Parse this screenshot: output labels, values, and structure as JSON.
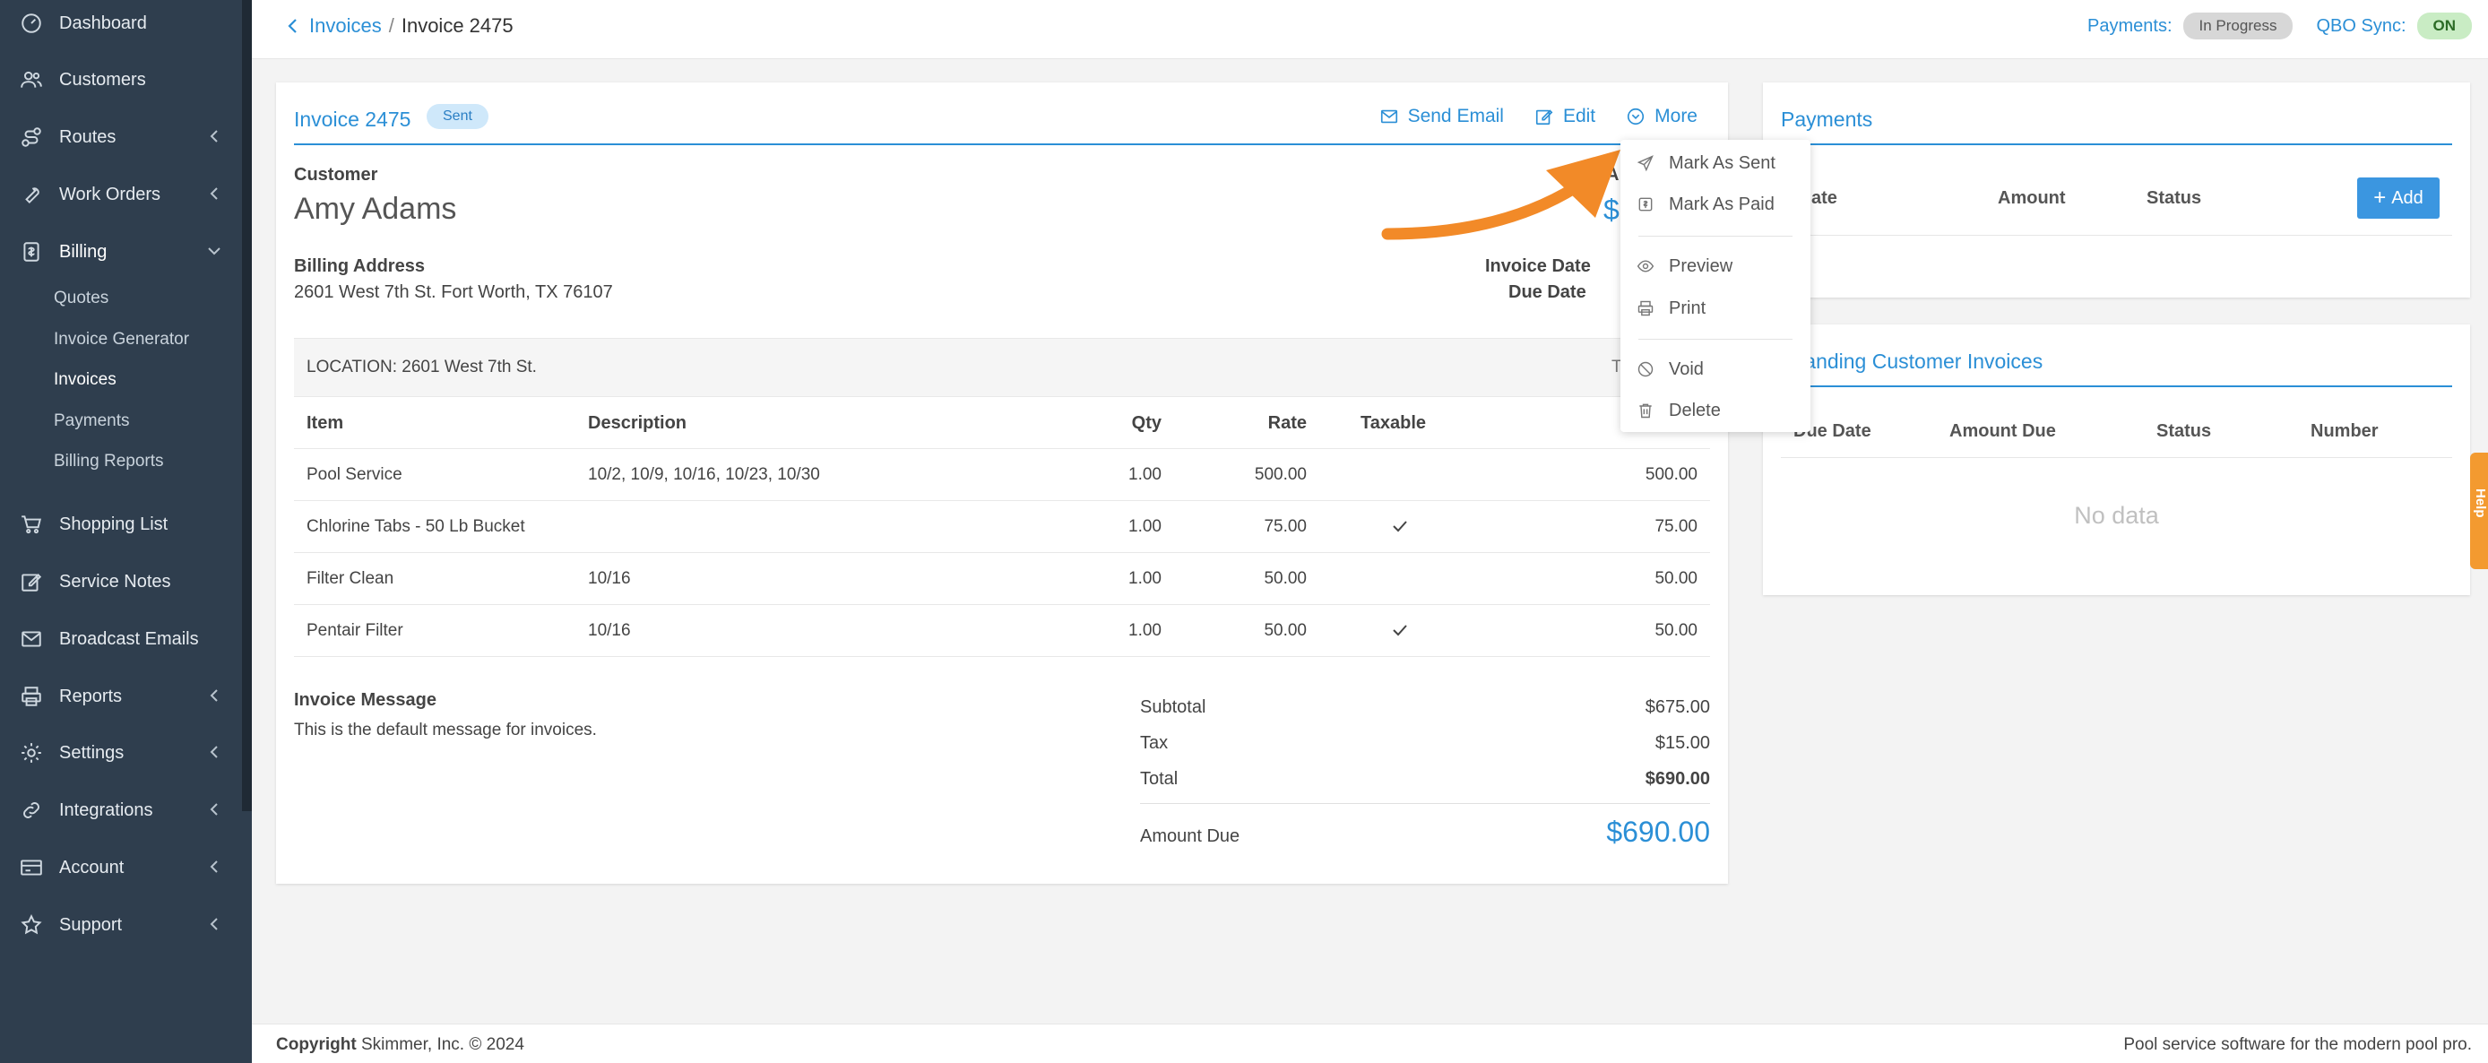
{
  "sidebar": {
    "items": [
      {
        "label": "Dashboard",
        "icon": "dashboard-icon"
      },
      {
        "label": "Customers",
        "icon": "users-icon"
      },
      {
        "label": "Routes",
        "icon": "route-icon"
      },
      {
        "label": "Work Orders",
        "icon": "wrench-icon"
      },
      {
        "label": "Billing",
        "icon": "billing-icon"
      },
      {
        "label": "Shopping List",
        "icon": "cart-icon"
      },
      {
        "label": "Service Notes",
        "icon": "edit-icon"
      },
      {
        "label": "Broadcast Emails",
        "icon": "mail-icon"
      },
      {
        "label": "Reports",
        "icon": "printer-icon"
      },
      {
        "label": "Settings",
        "icon": "gear-icon"
      },
      {
        "label": "Integrations",
        "icon": "link-icon"
      },
      {
        "label": "Account",
        "icon": "card-icon"
      },
      {
        "label": "Support",
        "icon": "star-icon"
      }
    ],
    "billing_sub": [
      "Quotes",
      "Invoice Generator",
      "Invoices",
      "Payments",
      "Billing Reports"
    ]
  },
  "topbar": {
    "crumb_parent": "Invoices",
    "crumb_sep": "/",
    "crumb_current": "Invoice 2475",
    "payments_label": "Payments:",
    "payments_status": "In Progress",
    "qbo_label": "QBO Sync:",
    "qbo_status": "ON"
  },
  "invoice": {
    "title": "Invoice 2475",
    "status_badge": "Sent",
    "actions": {
      "send_email": "Send Email",
      "edit": "Edit",
      "more": "More"
    },
    "customer_label": "Customer",
    "customer_name": "Amy Adams",
    "billing_address_label": "Billing Address",
    "billing_address": "2601 West 7th St. Fort Worth, TX 76107",
    "invoice_date_label": "Invoice Date",
    "due_date_label": "Due Date",
    "partial_a": "A",
    "partial_dollar": "$",
    "location": "LOCATION: 2601 West 7th St.",
    "location_tax": "Tax",
    "columns": {
      "item": "Item",
      "description": "Description",
      "qty": "Qty",
      "rate": "Rate",
      "taxable": "Taxable"
    },
    "rows": [
      {
        "item": "Pool Service",
        "description": "10/2, 10/9, 10/16, 10/23, 10/30",
        "qty": "1.00",
        "rate": "500.00",
        "taxable": false,
        "amount": "500.00"
      },
      {
        "item": "Chlorine Tabs - 50 Lb Bucket",
        "description": "",
        "qty": "1.00",
        "rate": "75.00",
        "taxable": true,
        "amount": "75.00"
      },
      {
        "item": "Filter Clean",
        "description": "10/16",
        "qty": "1.00",
        "rate": "50.00",
        "taxable": false,
        "amount": "50.00"
      },
      {
        "item": "Pentair Filter",
        "description": "10/16",
        "qty": "1.00",
        "rate": "50.00",
        "taxable": true,
        "amount": "50.00"
      }
    ],
    "message_label": "Invoice Message",
    "message": "This is the default message for invoices.",
    "subtotal_label": "Subtotal",
    "subtotal": "$675.00",
    "tax_label": "Tax",
    "tax": "$15.00",
    "total_label": "Total",
    "total": "$690.00",
    "amount_due_label": "Amount Due",
    "amount_due": "$690.00"
  },
  "more_menu": {
    "items": [
      {
        "label": "Mark As Sent",
        "icon": "send-icon"
      },
      {
        "label": "Mark As Paid",
        "icon": "dollar-icon"
      },
      {
        "label": "Preview",
        "icon": "eye-icon"
      },
      {
        "label": "Print",
        "icon": "printer-icon"
      },
      {
        "label": "Void",
        "icon": "ban-icon"
      },
      {
        "label": "Delete",
        "icon": "trash-icon"
      }
    ]
  },
  "payments": {
    "title": "Payments",
    "columns": {
      "date": "ate",
      "amount": "Amount",
      "status": "Status"
    },
    "add_label": "Add"
  },
  "outstanding": {
    "title": "tstanding Customer Invoices",
    "columns": {
      "due_date": "Due Date",
      "amount_due": "Amount Due",
      "status": "Status",
      "number": "Number"
    },
    "empty": "No data"
  },
  "help_label": "Help",
  "footer": {
    "copyright_bold": "Copyright",
    "copyright_rest": "Skimmer, Inc. © 2024",
    "tagline": "Pool service software for the modern pool pro."
  },
  "colors": {
    "accent": "#2b8fd6",
    "sidebar": "#2f3e4e",
    "annotation_arrow": "#f28a28",
    "help_tab": "#f39a30"
  }
}
